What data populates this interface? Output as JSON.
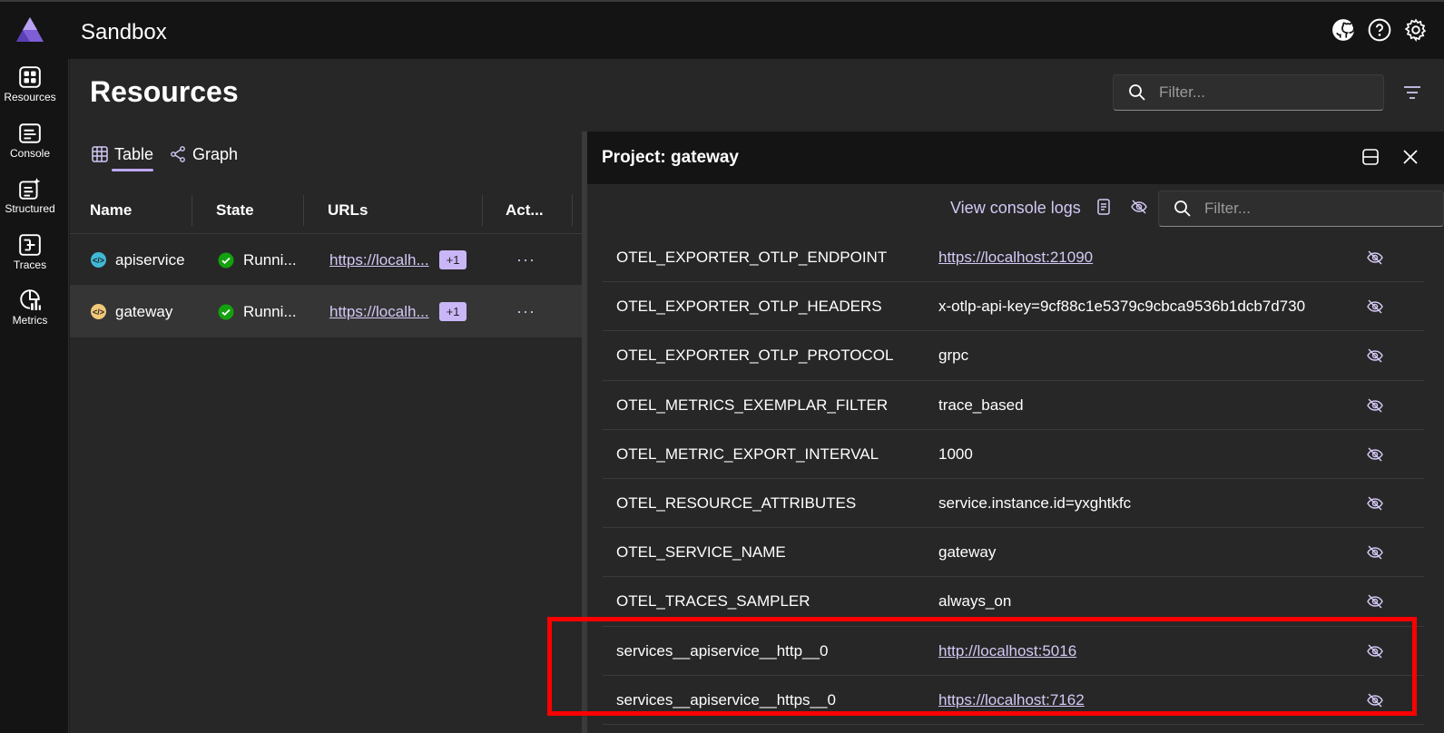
{
  "app": {
    "title": "Sandbox"
  },
  "header_icons": [
    "github-icon",
    "help-icon",
    "settings-icon"
  ],
  "nav": [
    {
      "label": "Resources",
      "icon": "resources-icon"
    },
    {
      "label": "Console",
      "icon": "console-icon"
    },
    {
      "label": "Structured",
      "icon": "structured-logs-icon"
    },
    {
      "label": "Traces",
      "icon": "traces-icon"
    },
    {
      "label": "Metrics",
      "icon": "metrics-icon"
    }
  ],
  "page": {
    "title": "Resources",
    "filter_placeholder": "Filter...",
    "tabs": [
      {
        "label": "Table",
        "active": true
      },
      {
        "label": "Graph",
        "active": false
      }
    ]
  },
  "table": {
    "columns": [
      "Name",
      "State",
      "URLs",
      "Act..."
    ],
    "rows": [
      {
        "name": "apiservice",
        "state": "Runni...",
        "url": "https://localh...",
        "extra": "+1",
        "actions": "···"
      },
      {
        "name": "gateway",
        "state": "Runni...",
        "url": "https://localh...",
        "extra": "+1",
        "actions": "···"
      }
    ]
  },
  "panel": {
    "title": "Project: gateway",
    "view_console_logs": "View console logs",
    "filter_placeholder": "Filter...",
    "env": [
      {
        "name": "OTEL_EXPORTER_OTLP_ENDPOINT",
        "value": "https://localhost:21090",
        "link": true
      },
      {
        "name": "OTEL_EXPORTER_OTLP_HEADERS",
        "value": "x-otlp-api-key=9cf88c1e5379c9cbca9536b1dcb7d730",
        "link": false
      },
      {
        "name": "OTEL_EXPORTER_OTLP_PROTOCOL",
        "value": "grpc",
        "link": false
      },
      {
        "name": "OTEL_METRICS_EXEMPLAR_FILTER",
        "value": "trace_based",
        "link": false
      },
      {
        "name": "OTEL_METRIC_EXPORT_INTERVAL",
        "value": "1000",
        "link": false
      },
      {
        "name": "OTEL_RESOURCE_ATTRIBUTES",
        "value": "service.instance.id=yxghtkfc",
        "link": false
      },
      {
        "name": "OTEL_SERVICE_NAME",
        "value": "gateway",
        "link": false
      },
      {
        "name": "OTEL_TRACES_SAMPLER",
        "value": "always_on",
        "link": false
      },
      {
        "name": "services__apiservice__http__0",
        "value": "http://localhost:5016",
        "link": true
      },
      {
        "name": "services__apiservice__https__0",
        "value": "https://localhost:7162",
        "link": true
      }
    ]
  },
  "colors": {
    "accent": "#c9b6f7",
    "link": "#d4c8f5",
    "running": "#13a10e",
    "highlight": "#ff0000"
  }
}
